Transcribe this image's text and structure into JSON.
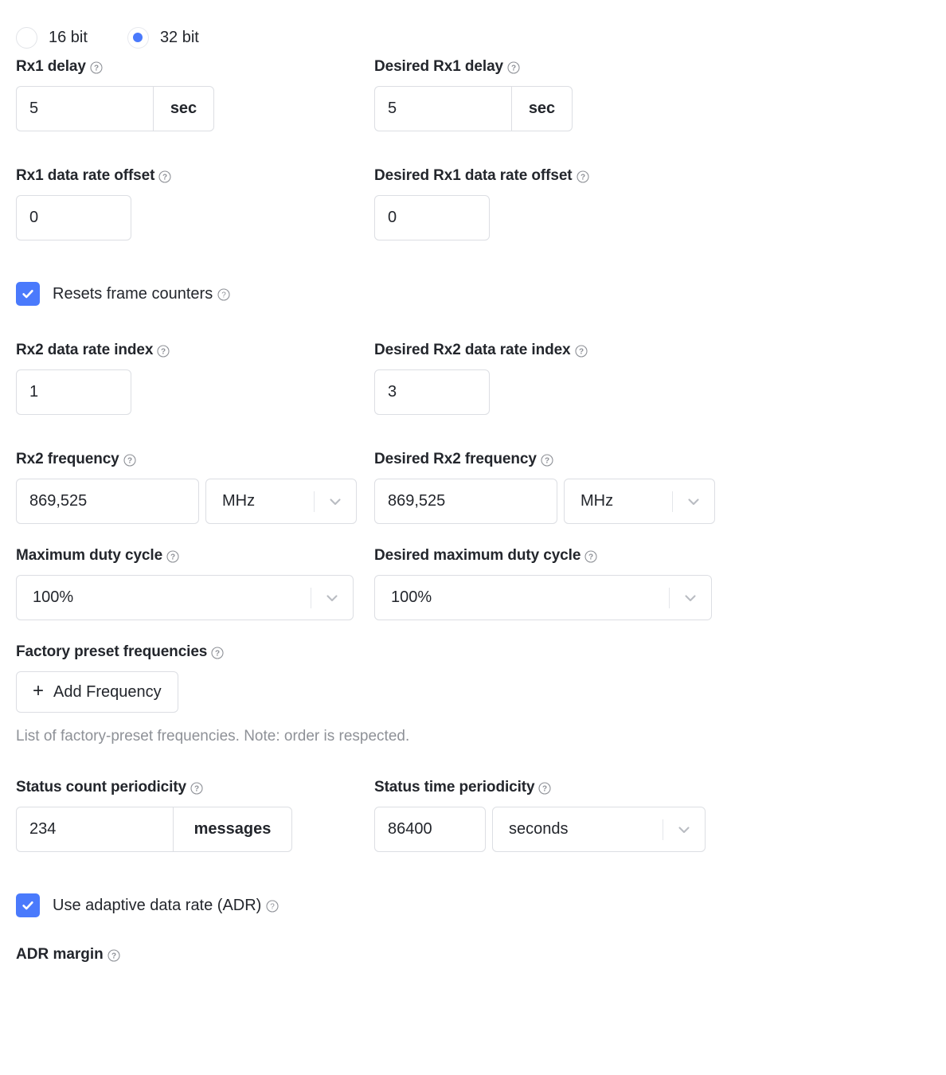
{
  "bit_mode": {
    "options": [
      {
        "label": "16 bit",
        "selected": false
      },
      {
        "label": "32 bit",
        "selected": true
      }
    ]
  },
  "fields": {
    "rx1_delay": {
      "label": "Rx1 delay",
      "value": "5",
      "unit": "sec"
    },
    "desired_rx1_delay": {
      "label": "Desired Rx1 delay",
      "value": "5",
      "unit": "sec"
    },
    "rx1_dr_offset": {
      "label": "Rx1 data rate offset",
      "value": "0"
    },
    "desired_rx1_dr_offset": {
      "label": "Desired Rx1 data rate offset",
      "value": "0"
    },
    "rx2_dr_index": {
      "label": "Rx2 data rate index",
      "value": "1"
    },
    "desired_rx2_dr_index": {
      "label": "Desired Rx2 data rate index",
      "value": "3"
    },
    "rx2_frequency": {
      "label": "Rx2 frequency",
      "value": "869,525",
      "unit": "MHz"
    },
    "desired_rx2_frequency": {
      "label": "Desired Rx2 frequency",
      "value": "869,525",
      "unit": "MHz"
    },
    "max_duty_cycle": {
      "label": "Maximum duty cycle",
      "value": "100%"
    },
    "desired_max_duty_cycle": {
      "label": "Desired maximum duty cycle",
      "value": "100%"
    },
    "factory_preset_freqs": {
      "label": "Factory preset frequencies",
      "button_label": "Add Frequency",
      "plus": "+",
      "hint": "List of factory-preset frequencies. Note: order is respected."
    },
    "status_count_periodicity": {
      "label": "Status count periodicity",
      "value": "234",
      "unit": "messages"
    },
    "status_time_periodicity": {
      "label": "Status time periodicity",
      "value": "86400",
      "unit": "seconds"
    },
    "adr_margin": {
      "label": "ADR margin"
    }
  },
  "checkboxes": {
    "resets_frame_counters": {
      "label": "Resets frame counters",
      "checked": true
    },
    "use_adr": {
      "label": "Use adaptive data rate (ADR)",
      "checked": true
    }
  },
  "icons": {
    "help": "help-circle-icon",
    "chevron": "chevron-down-icon",
    "check": "check-icon",
    "plus": "plus-icon"
  },
  "colors": {
    "accent": "#4a7afc",
    "text": "#23262c",
    "muted": "#8e9197",
    "border": "#dcdee3",
    "page_bg": "#ffffff"
  }
}
